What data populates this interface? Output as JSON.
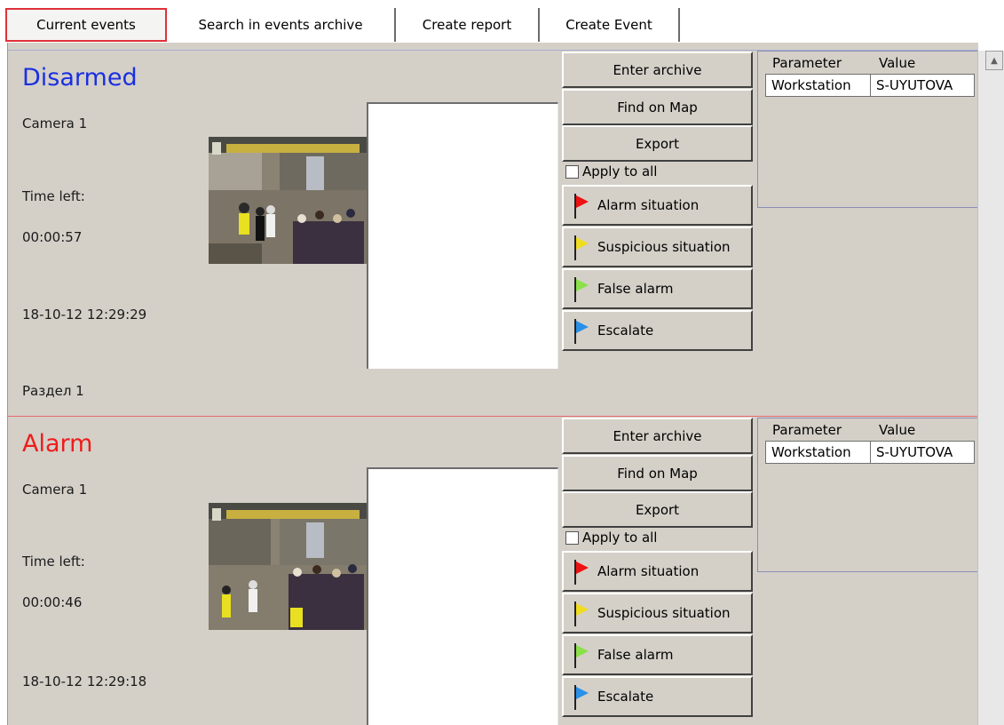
{
  "tabs": [
    {
      "label": "Current events",
      "active": true
    },
    {
      "label": "Search in events archive",
      "active": false
    },
    {
      "label": "Create report",
      "active": false
    },
    {
      "label": "Create Event",
      "active": false
    }
  ],
  "events": [
    {
      "status": "Disarmed",
      "status_color": "#1a2fe0",
      "separator_color": "#a9acd0",
      "camera": "Camera 1",
      "time_left_label": "Time left:",
      "time_left": "00:00:57",
      "timestamp": "18-10-12 12:29:29",
      "section": "Раздел 1",
      "buttons": {
        "enter_archive": "Enter archive",
        "find_on_map": "Find on Map",
        "export": "Export",
        "apply_to_all": "Apply to all",
        "alarm": "Alarm situation",
        "suspicious": "Suspicious situation",
        "false_alarm": "False alarm",
        "escalate": "Escalate"
      },
      "params": {
        "header_param": "Parameter",
        "header_value": "Value",
        "param": "Workstation",
        "value": "S-UYUTOVA"
      }
    },
    {
      "status": "Alarm",
      "status_color": "#ee1c1c",
      "separator_color": "#e86a6a",
      "camera": "Camera 1",
      "time_left_label": "Time left:",
      "time_left": "00:00:46",
      "timestamp": "18-10-12 12:29:18",
      "buttons": {
        "enter_archive": "Enter archive",
        "find_on_map": "Find on Map",
        "export": "Export",
        "apply_to_all": "Apply to all",
        "alarm": "Alarm situation",
        "suspicious": "Suspicious situation",
        "false_alarm": "False alarm",
        "escalate": "Escalate"
      },
      "params": {
        "header_param": "Parameter",
        "header_value": "Value",
        "param": "Workstation",
        "value": "S-UYUTOVA"
      }
    }
  ],
  "flag_colors": {
    "alarm": "#ee1111",
    "suspicious": "#f0dc20",
    "false_alarm": "#8ce04a",
    "escalate": "#2a90e8"
  }
}
